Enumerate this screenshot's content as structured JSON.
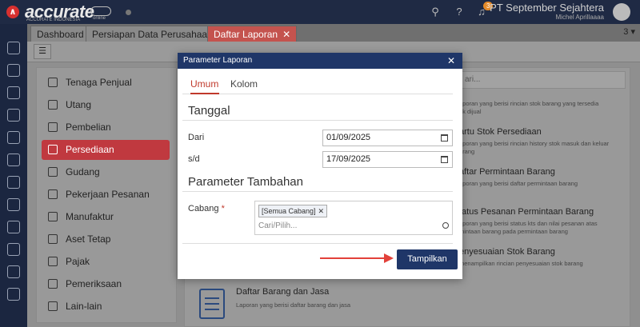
{
  "topbar": {
    "brand": "accurate",
    "brand_sub": "ACCURATE INDONESIA",
    "cloud_label": "online",
    "notification_count": "3",
    "company": "PT September Sejahtera",
    "user": "Michel Aprillaaaa"
  },
  "tabs": [
    {
      "label": "Dashboard"
    },
    {
      "label": "Persiapan Data Perusahaan"
    },
    {
      "label": "Daftar Laporan"
    }
  ],
  "tabs_more": "3",
  "menu": [
    {
      "label": "Tenaga Penjual"
    },
    {
      "label": "Utang"
    },
    {
      "label": "Pembelian"
    },
    {
      "label": "Persediaan"
    },
    {
      "label": "Gudang"
    },
    {
      "label": "Pekerjaan Pesanan"
    },
    {
      "label": "Manufaktur"
    },
    {
      "label": "Aset Tetap"
    },
    {
      "label": "Pajak"
    },
    {
      "label": "Pemeriksaan"
    },
    {
      "label": "Lain-lain"
    }
  ],
  "search_placeholder": "ari...",
  "reports": [
    {
      "title": "",
      "desc": "oporan yang berisi rincian stok barang yang tersedia\nuk dijual"
    },
    {
      "title": "artu Stok Persediaan",
      "desc": "oporan yang berisi rincian history stok masuk dan keluar\narang"
    },
    {
      "title": "aftar Permintaan Barang",
      "desc": "oporan yang berisi daftar permintaan barang"
    },
    {
      "title": "tatus Pesanan Permintaan Barang",
      "desc": "oporan yang berisi status kts dan nilai pesanan atas\nmintaan barang pada permintaan barang"
    },
    {
      "title": "enyesuaian Stok Barang",
      "desc": "menampilkan rincian penyesuaian stok barang"
    },
    {
      "title": "Daftar Barang dan Jasa",
      "desc": "Laporan yang berisi daftar barang dan jasa"
    }
  ],
  "modal": {
    "title": "Parameter Laporan",
    "tab_umum": "Umum",
    "tab_kolom": "Kolom",
    "section_tanggal": "Tanggal",
    "dari_label": "Dari",
    "dari_value": "01/09/2025",
    "sd_label": "s/d",
    "sd_value": "17/09/2025",
    "section_tambahan": "Parameter Tambahan",
    "cabang_label": "Cabang",
    "required_mark": "*",
    "cabang_chip": "[Semua Cabang]",
    "cabang_placeholder": "Cari/Pilih...",
    "submit": "Tampilkan"
  }
}
